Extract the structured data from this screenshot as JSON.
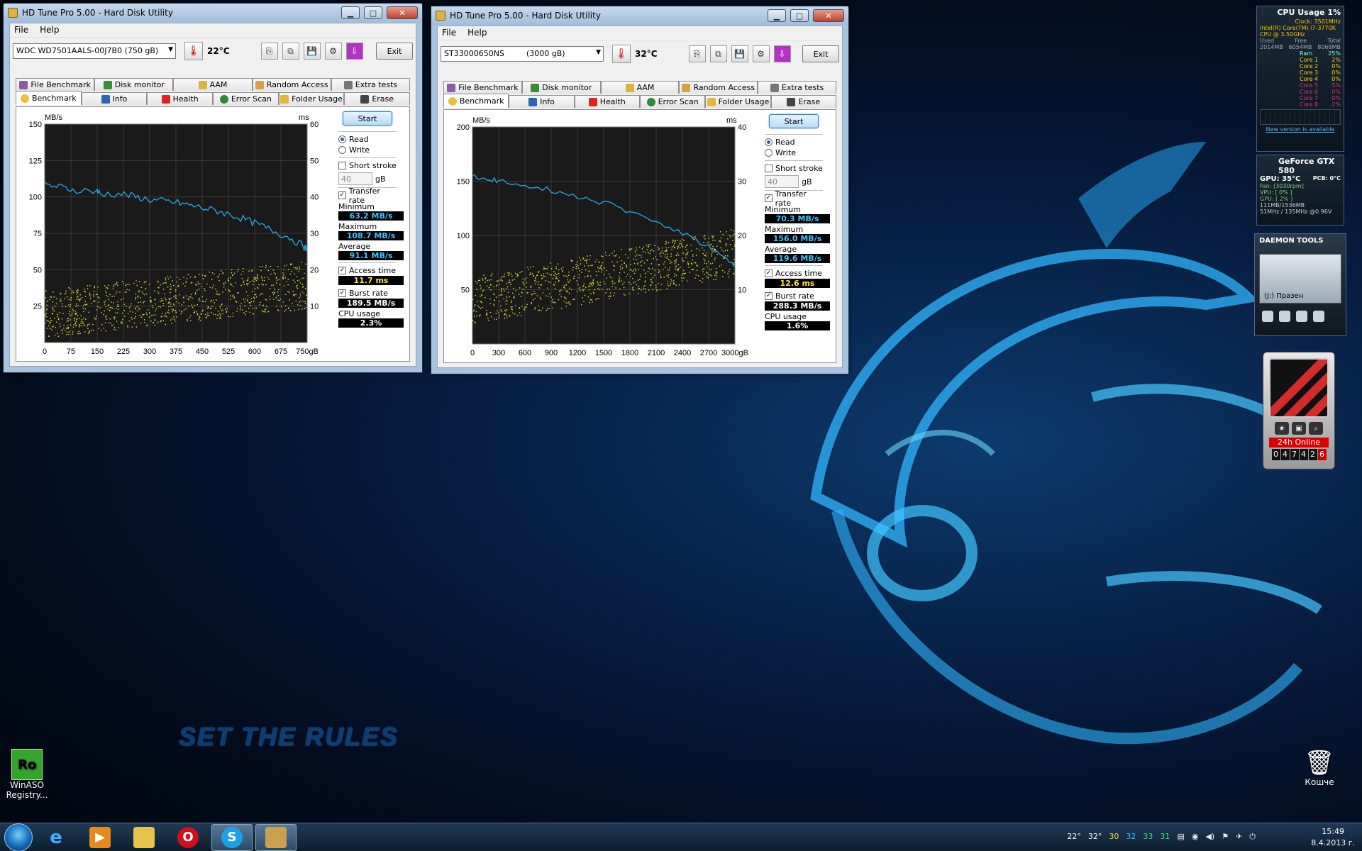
{
  "desktop": {
    "slogan": "SET THE RULES",
    "icons": [
      {
        "name": "WinASO Registry...",
        "glyph": "Ro"
      },
      {
        "name": "Кошче",
        "glyph": "🗑"
      }
    ]
  },
  "window1": {
    "title": "HD Tune Pro 5.00 - Hard Disk Utility",
    "menu": [
      "File",
      "Help"
    ],
    "drive": "WDC WD7501AALS-00J7B0 (750 gB)",
    "temperature": "22°C",
    "exit": "Exit",
    "tabs_top": [
      "File Benchmark",
      "Disk monitor",
      "AAM",
      "Random Access",
      "Extra tests"
    ],
    "tabs_bottom": [
      "Benchmark",
      "Info",
      "Health",
      "Error Scan",
      "Folder Usage",
      "Erase"
    ],
    "start": "Start",
    "read": "Read",
    "write": "Write",
    "short_stroke": "Short stroke",
    "stroke_value": "40",
    "stroke_unit": "gB",
    "transfer_rate": "Transfer rate",
    "minimum_label": "Minimum",
    "minimum": "63.2 MB/s",
    "maximum_label": "Maximum",
    "maximum": "108.7 MB/s",
    "average_label": "Average",
    "average": "91.1 MB/s",
    "access_time_label": "Access time",
    "access_time": "11.7 ms",
    "burst_rate_label": "Burst rate",
    "burst_rate": "189.5 MB/s",
    "cpu_usage_label": "CPU usage",
    "cpu_usage": "2.3%"
  },
  "window2": {
    "title": "HD Tune Pro 5.00 - Hard Disk Utility",
    "menu": [
      "File",
      "Help"
    ],
    "drive": "ST33000650NS",
    "drive_size": "(3000 gB)",
    "temperature": "32°C",
    "exit": "Exit",
    "tabs_top": [
      "File Benchmark",
      "Disk monitor",
      "AAM",
      "Random Access",
      "Extra tests"
    ],
    "tabs_bottom": [
      "Benchmark",
      "Info",
      "Health",
      "Error Scan",
      "Folder Usage",
      "Erase"
    ],
    "start": "Start",
    "read": "Read",
    "write": "Write",
    "short_stroke": "Short stroke",
    "stroke_value": "40",
    "stroke_unit": "gB",
    "transfer_rate": "Transfer rate",
    "minimum_label": "Minimum",
    "minimum": "70.3 MB/s",
    "maximum_label": "Maximum",
    "maximum": "156.0 MB/s",
    "average_label": "Average",
    "average": "119.6 MB/s",
    "access_time_label": "Access time",
    "access_time": "12.6 ms",
    "burst_rate_label": "Burst rate",
    "burst_rate": "288.3 MB/s",
    "cpu_usage_label": "CPU usage",
    "cpu_usage": "1.6%"
  },
  "chart_data": [
    {
      "type": "line",
      "title": "",
      "ylabel": "MB/s",
      "y2label": "ms",
      "xlabel": "gB",
      "xlim": [
        0,
        750
      ],
      "ylim": [
        0,
        150
      ],
      "y2lim": [
        0,
        60
      ],
      "xticks": [
        "0",
        "75",
        "150",
        "225",
        "300",
        "375",
        "450",
        "525",
        "600",
        "675",
        "750gB"
      ],
      "yticks": [
        "150",
        "125",
        "100",
        "75",
        "50",
        "25"
      ],
      "y2ticks": [
        "60",
        "50",
        "40",
        "30",
        "20",
        "10"
      ],
      "grid": true,
      "series": [
        {
          "name": "Transfer rate",
          "color": "#2aa7e6",
          "x": [
            0,
            40,
            80,
            150,
            160,
            220,
            260,
            300,
            340,
            380,
            420,
            460,
            500,
            540,
            580,
            620,
            660,
            700,
            740,
            750
          ],
          "values": [
            108,
            107,
            105,
            104,
            102,
            102,
            100,
            98,
            97,
            96,
            94,
            92,
            90,
            87,
            84,
            80,
            76,
            72,
            66,
            63
          ]
        },
        {
          "name": "Access time",
          "color": "#e6e13a",
          "axis": "y2",
          "kind": "scatter",
          "trend_x": [
            0,
            750
          ],
          "trend_ms": [
            8,
            16
          ]
        }
      ]
    },
    {
      "type": "line",
      "title": "",
      "ylabel": "MB/s",
      "y2label": "ms",
      "xlabel": "gB",
      "xlim": [
        0,
        3000
      ],
      "ylim": [
        0,
        200
      ],
      "y2lim": [
        0,
        40
      ],
      "xticks": [
        "0",
        "300",
        "600",
        "900",
        "1200",
        "1500",
        "1800",
        "2100",
        "2400",
        "2700",
        "3000gB"
      ],
      "yticks": [
        "200",
        "150",
        "100",
        "50"
      ],
      "y2ticks": [
        "40",
        "30",
        "20",
        "10"
      ],
      "grid": true,
      "series": [
        {
          "name": "Transfer rate",
          "color": "#2aa7e6",
          "x": [
            0,
            150,
            300,
            600,
            900,
            1200,
            1500,
            1800,
            2100,
            2400,
            2700,
            2900,
            3000
          ],
          "values": [
            154,
            152,
            150,
            147,
            142,
            136,
            130,
            122,
            113,
            102,
            90,
            78,
            71
          ]
        },
        {
          "name": "Access time",
          "color": "#e6e13a",
          "axis": "y2",
          "kind": "scatter",
          "trend_x": [
            0,
            3000
          ],
          "trend_ms": [
            8,
            17
          ]
        }
      ]
    }
  ],
  "gadgets": {
    "cpu": {
      "title": "CPU Usage",
      "percent": "1%",
      "clock": "Clock: 3501MHz",
      "model": "Intel(R) Core(TM) i7-3770K",
      "speed": "CPU @ 3.50GHz",
      "mem_headers": [
        "Used",
        "Free",
        "Total"
      ],
      "mem_values": [
        "2014MB",
        "6054MB",
        "8068MB"
      ],
      "ram": "Ram",
      "ram_pct": "25%",
      "cores": [
        {
          "name": "Core 1",
          "pct": "2%"
        },
        {
          "name": "Core 2",
          "pct": "0%"
        },
        {
          "name": "Core 3",
          "pct": "0%"
        },
        {
          "name": "Core 4",
          "pct": "0%"
        },
        {
          "name": "Core 5",
          "pct": "5%"
        },
        {
          "name": "Core 6",
          "pct": "0%"
        },
        {
          "name": "Core 7",
          "pct": "0%"
        },
        {
          "name": "Core 8",
          "pct": "2%"
        }
      ],
      "new_version": "New version is available"
    },
    "gpu": {
      "title": "GeForce GTX 580",
      "gpu_temp": "GPU: 35°C",
      "pcb": "PCB: 0°C",
      "fan": "Fan: [3030rpm]",
      "vpu": "VPU: [ 0% ]",
      "gpu_load": "GPU: [ 2% ]",
      "memory": "111MB/1536MB",
      "clocks": "51MHz / 135MHz @0.96V"
    },
    "daemon": {
      "title": "DAEMON TOOLS",
      "drive": "(J:) Празен"
    },
    "counter": {
      "online": "24h Online",
      "digits": [
        "0",
        "4",
        "7",
        "4",
        "2",
        "6"
      ]
    }
  },
  "taskbar": {
    "temps": [
      "22°",
      "32°",
      "30",
      "32",
      "33",
      "31"
    ],
    "time": "15:49",
    "date": "8.4.2013 г."
  },
  "colors": {
    "transfer_line": "#2aa7e6",
    "access_dots": "#e6e13a",
    "chart_bg": "#1a1a1a",
    "grid": "#3a3a3a",
    "value_blue": "#3fc3ff",
    "value_yellow": "#ffe43a"
  }
}
